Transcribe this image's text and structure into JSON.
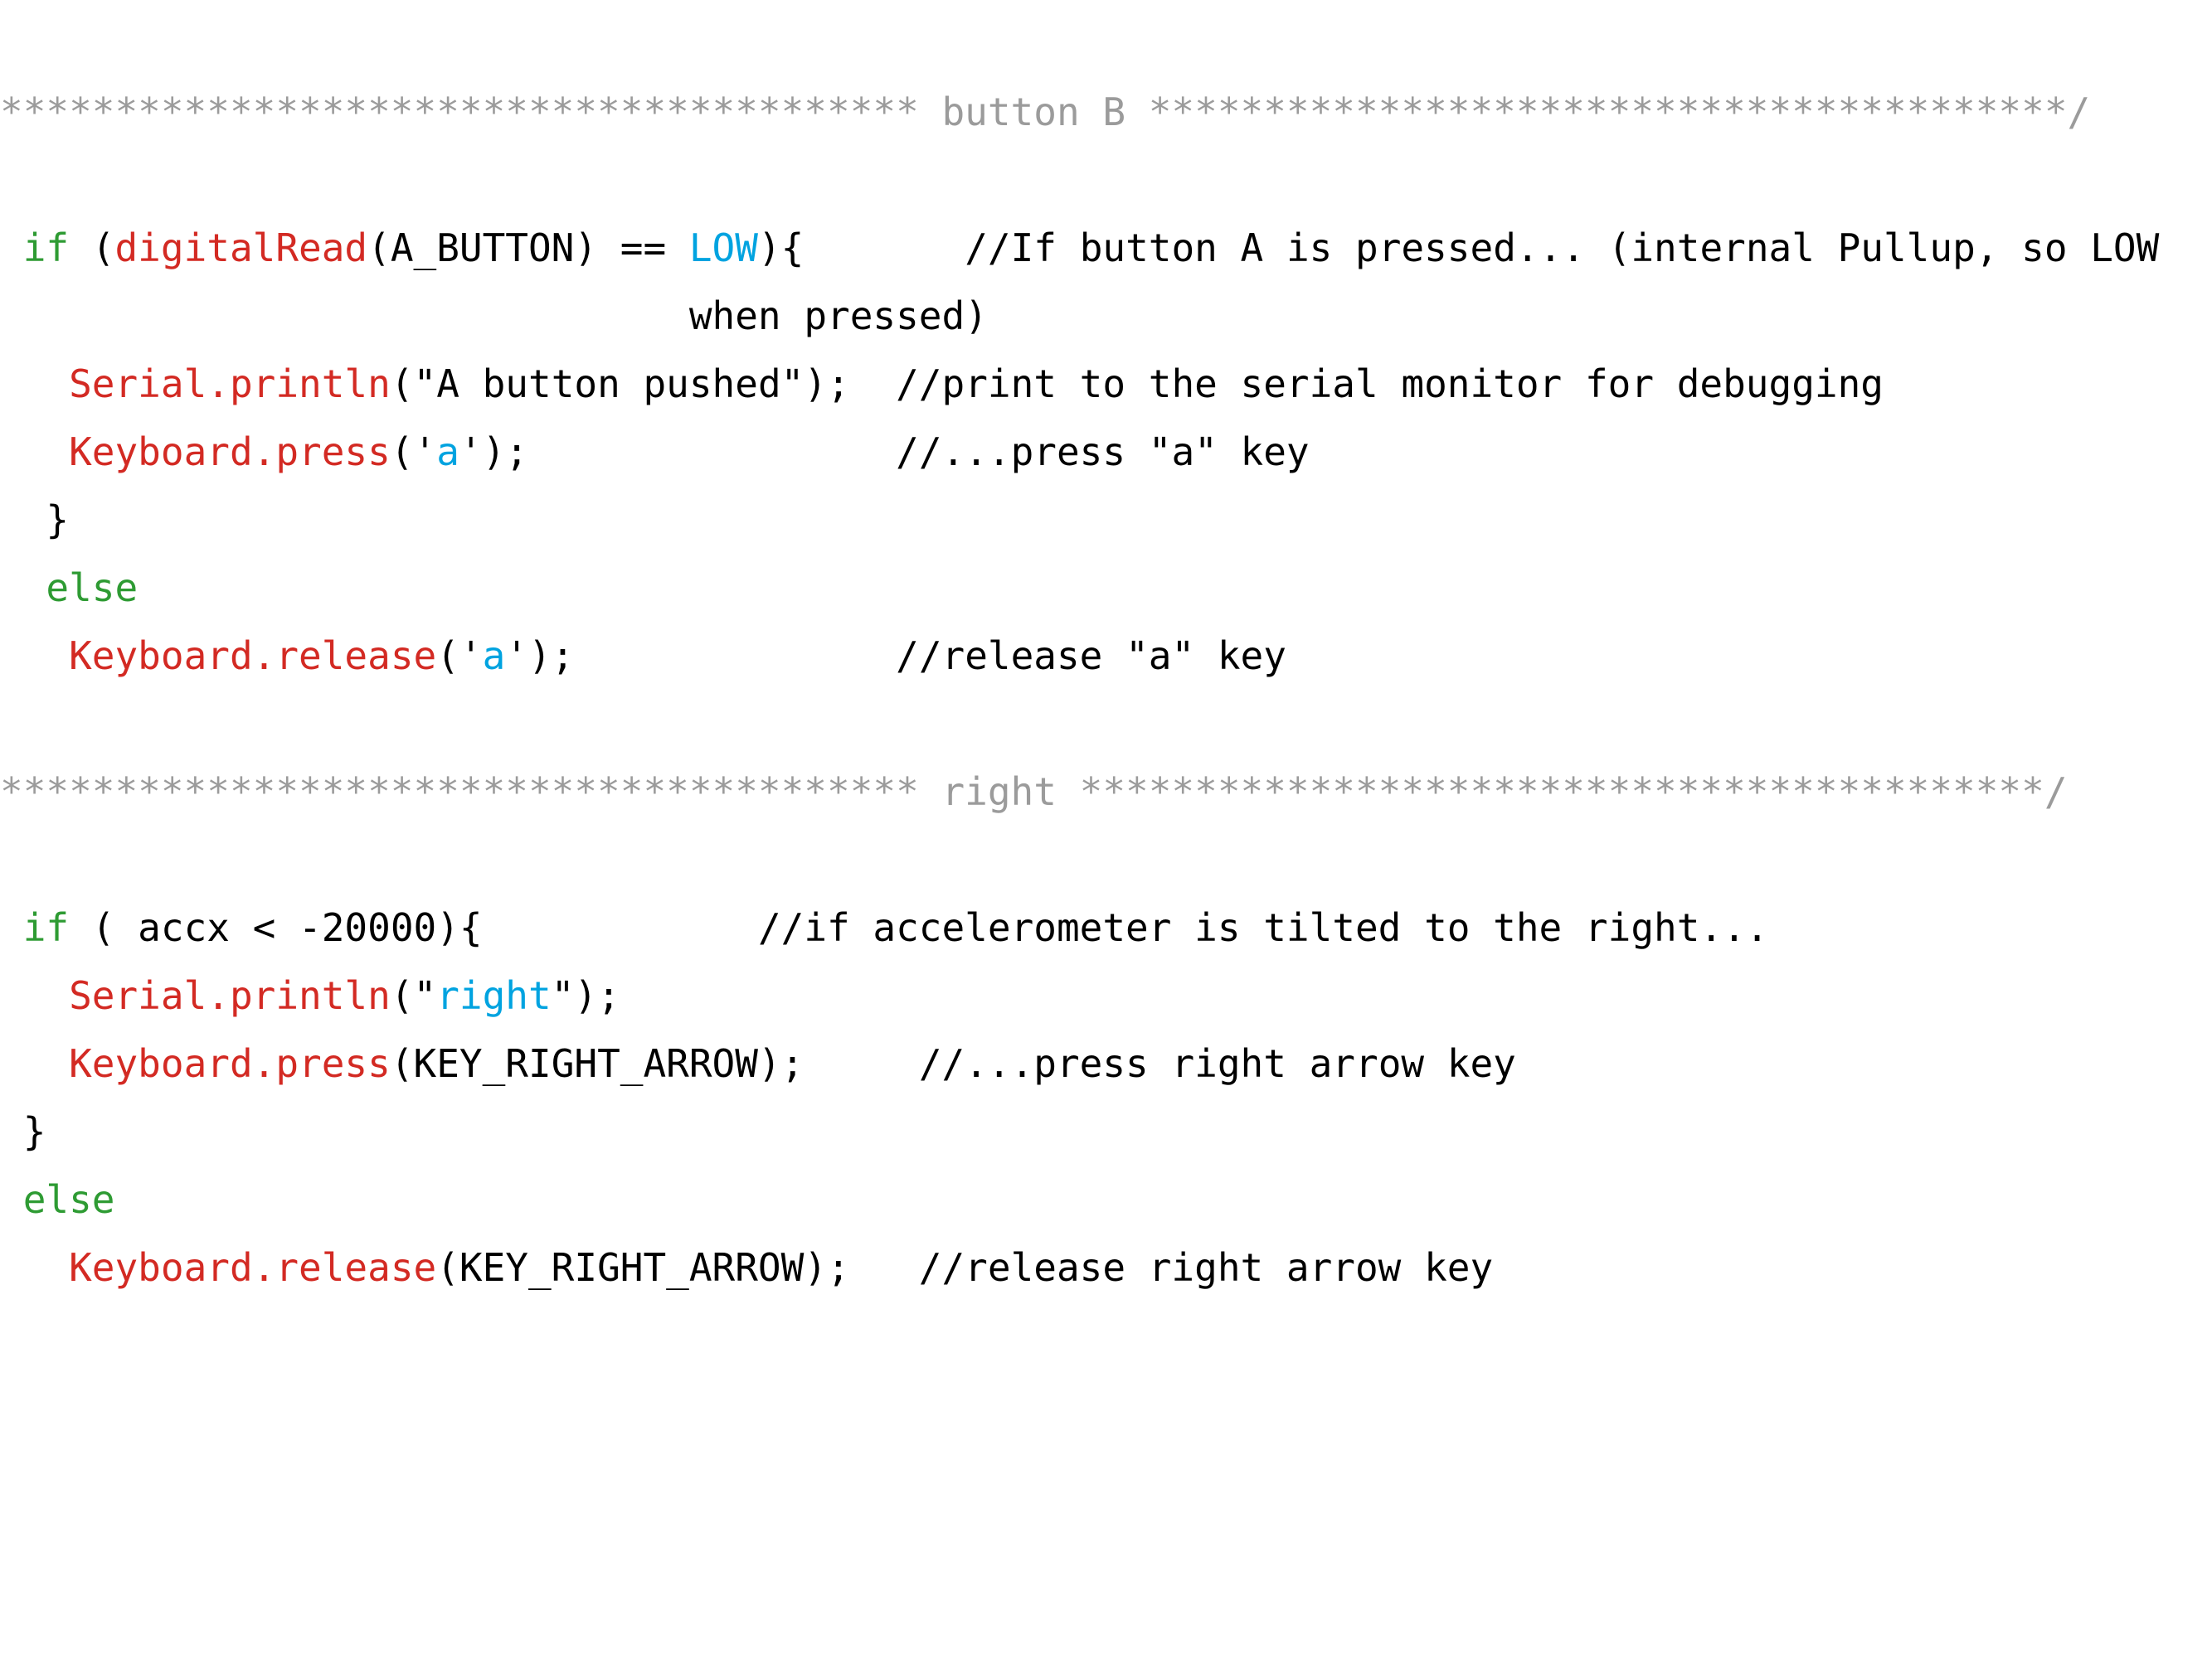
{
  "document": {
    "kind": "source-code-listing",
    "language": "Arduino C++",
    "background_color": "#ffffff",
    "font_style": "monospace"
  },
  "colors": {
    "banner_comment": "#9b9b9b",
    "line_comment": "#1a1a1a",
    "keyword": "#2e9b33",
    "function": "#d32a23",
    "literal": "#00a3e0",
    "plain": "#000000"
  },
  "banners": {
    "button_b": {
      "stars_left": "****************************************",
      "label": " button B ",
      "stars_right": "****************************************/"
    },
    "right": {
      "stars_left": "****************************************",
      "label": " right ",
      "stars_right": "******************************************/"
    }
  },
  "lines": [
    {
      "id": "banner-button-b",
      "type": "banner",
      "segments": [
        {
          "text": "****************************************",
          "token": "comment"
        },
        {
          "text": " button B ",
          "token": "comment"
        },
        {
          "text": "****************************************/",
          "token": "comment"
        }
      ]
    },
    {
      "id": "blank-1",
      "type": "blank",
      "segments": []
    },
    {
      "id": "code-if-digitalread",
      "type": "code",
      "segments": [
        {
          "text": " ",
          "token": "plain"
        },
        {
          "text": "if",
          "token": "keyword"
        },
        {
          "text": " (",
          "token": "plain"
        },
        {
          "text": "digitalRead",
          "token": "func"
        },
        {
          "text": "(A_BUTTON) == ",
          "token": "plain"
        },
        {
          "text": "LOW",
          "token": "literal"
        },
        {
          "text": "){",
          "token": "plain"
        },
        {
          "text": "       ",
          "token": "plain"
        },
        {
          "text": "//If button A is pressed... (internal Pullup, so LOW",
          "token": "linecom"
        }
      ]
    },
    {
      "id": "comment-when-pressed",
      "type": "comment-continuation",
      "segments": [
        {
          "text": "                              ",
          "token": "plain"
        },
        {
          "text": "when pressed)",
          "token": "linecom"
        }
      ]
    },
    {
      "id": "code-serial-println-a",
      "type": "code",
      "segments": [
        {
          "text": "   ",
          "token": "plain"
        },
        {
          "text": "Serial.println",
          "token": "func"
        },
        {
          "text": "(\"A button pushed\");",
          "token": "plain"
        },
        {
          "text": "  ",
          "token": "plain"
        },
        {
          "text": "//print to the serial monitor for debugging",
          "token": "linecom"
        }
      ]
    },
    {
      "id": "code-keyboard-press-a",
      "type": "code",
      "segments": [
        {
          "text": "   ",
          "token": "plain"
        },
        {
          "text": "Keyboard.press",
          "token": "func"
        },
        {
          "text": "('",
          "token": "plain"
        },
        {
          "text": "a",
          "token": "literal"
        },
        {
          "text": "');",
          "token": "plain"
        },
        {
          "text": "                ",
          "token": "plain"
        },
        {
          "text": "//...press \"a\" key",
          "token": "linecom"
        }
      ]
    },
    {
      "id": "code-close-brace-1",
      "type": "code",
      "segments": [
        {
          "text": "  }",
          "token": "plain"
        }
      ]
    },
    {
      "id": "code-else-1",
      "type": "code",
      "segments": [
        {
          "text": "  ",
          "token": "plain"
        },
        {
          "text": "else",
          "token": "keyword"
        }
      ]
    },
    {
      "id": "code-keyboard-release-a",
      "type": "code",
      "segments": [
        {
          "text": "   ",
          "token": "plain"
        },
        {
          "text": "Keyboard.release",
          "token": "func"
        },
        {
          "text": "('",
          "token": "plain"
        },
        {
          "text": "a",
          "token": "literal"
        },
        {
          "text": "');",
          "token": "plain"
        },
        {
          "text": "              ",
          "token": "plain"
        },
        {
          "text": "//release \"a\" key",
          "token": "linecom"
        }
      ]
    },
    {
      "id": "blank-2",
      "type": "blank",
      "segments": []
    },
    {
      "id": "banner-right",
      "type": "banner",
      "segments": [
        {
          "text": "****************************************",
          "token": "comment"
        },
        {
          "text": " right ",
          "token": "comment"
        },
        {
          "text": "******************************************/",
          "token": "comment"
        }
      ]
    },
    {
      "id": "blank-3",
      "type": "blank",
      "segments": []
    },
    {
      "id": "code-if-accx",
      "type": "code",
      "segments": [
        {
          "text": " ",
          "token": "plain"
        },
        {
          "text": "if",
          "token": "keyword"
        },
        {
          "text": " ( accx < -20000){",
          "token": "plain"
        },
        {
          "text": "            ",
          "token": "plain"
        },
        {
          "text": "//if accelerometer is tilted to the right...",
          "token": "linecom"
        }
      ]
    },
    {
      "id": "code-serial-println-right",
      "type": "code",
      "segments": [
        {
          "text": "   ",
          "token": "plain"
        },
        {
          "text": "Serial.println",
          "token": "func"
        },
        {
          "text": "(\"",
          "token": "plain"
        },
        {
          "text": "right",
          "token": "literal"
        },
        {
          "text": "\");",
          "token": "plain"
        }
      ]
    },
    {
      "id": "code-keyboard-press-right-arrow",
      "type": "code",
      "segments": [
        {
          "text": "   ",
          "token": "plain"
        },
        {
          "text": "Keyboard.press",
          "token": "func"
        },
        {
          "text": "(KEY_RIGHT_ARROW);",
          "token": "plain"
        },
        {
          "text": "     ",
          "token": "plain"
        },
        {
          "text": "//...press right arrow key",
          "token": "linecom"
        }
      ]
    },
    {
      "id": "code-close-brace-2",
      "type": "code",
      "segments": [
        {
          "text": " }",
          "token": "plain"
        }
      ]
    },
    {
      "id": "code-else-2",
      "type": "code",
      "segments": [
        {
          "text": " ",
          "token": "plain"
        },
        {
          "text": "else",
          "token": "keyword"
        }
      ]
    },
    {
      "id": "code-keyboard-release-right-arrow",
      "type": "code",
      "segments": [
        {
          "text": "   ",
          "token": "plain"
        },
        {
          "text": "Keyboard.release",
          "token": "func"
        },
        {
          "text": "(KEY_RIGHT_ARROW);",
          "token": "plain"
        },
        {
          "text": "   ",
          "token": "plain"
        },
        {
          "text": "//release right arrow key",
          "token": "linecom"
        }
      ]
    }
  ]
}
